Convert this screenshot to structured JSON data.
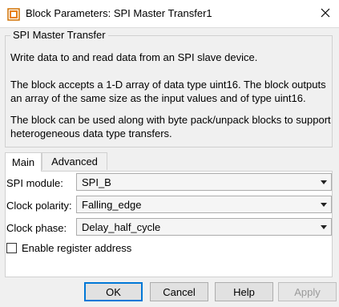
{
  "window": {
    "title": "Block Parameters: SPI Master Transfer1",
    "icon": "simulink-block-icon",
    "close_icon": "close-icon"
  },
  "group": {
    "legend": "SPI Master Transfer",
    "paragraphs": [
      "Write data to and read data from an SPI slave device.",
      "The block accepts a 1-D array of data type uint16. The block outputs an array of the same size as the input values and of type uint16.",
      "The block can be used along with byte pack/unpack blocks to support heterogeneous data type transfers."
    ]
  },
  "tabs": [
    {
      "label": "Main",
      "active": true
    },
    {
      "label": "Advanced",
      "active": false
    }
  ],
  "main": {
    "spi_module": {
      "label": "SPI module:",
      "value": "SPI_B"
    },
    "clock_polarity": {
      "label": "Clock polarity:",
      "value": "Falling_edge"
    },
    "clock_phase": {
      "label": "Clock phase:",
      "value": "Delay_half_cycle"
    },
    "enable_register_address": {
      "label": "Enable register address",
      "checked": false
    }
  },
  "buttons": {
    "ok": "OK",
    "cancel": "Cancel",
    "help": "Help",
    "apply": "Apply"
  }
}
